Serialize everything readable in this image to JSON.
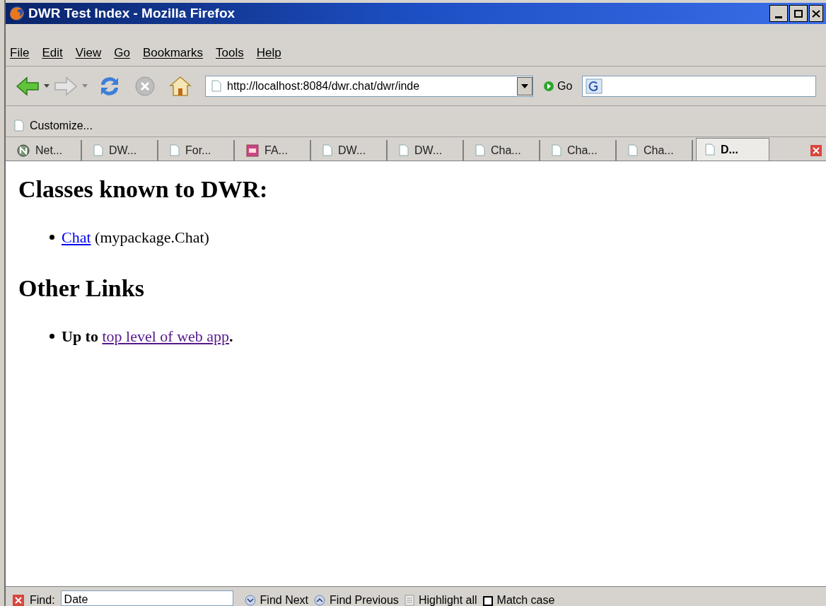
{
  "window": {
    "title": "DWR Test Index - Mozilla Firefox"
  },
  "menu": [
    "File",
    "Edit",
    "View",
    "Go",
    "Bookmarks",
    "Tools",
    "Help"
  ],
  "toolbar": {
    "url": "http://localhost:8084/dwr.chat/dwr/inde",
    "go": "Go"
  },
  "bookmarks": [
    "Customize..."
  ],
  "tabs": [
    {
      "label": "Net...",
      "kind": "globe",
      "selected": false
    },
    {
      "label": "DW...",
      "kind": "page",
      "selected": false
    },
    {
      "label": "For...",
      "kind": "page",
      "selected": false
    },
    {
      "label": "FA...",
      "kind": "jot",
      "selected": false
    },
    {
      "label": "DW...",
      "kind": "page",
      "selected": false
    },
    {
      "label": "DW...",
      "kind": "page",
      "selected": false
    },
    {
      "label": "Cha...",
      "kind": "page",
      "selected": false
    },
    {
      "label": "Cha...",
      "kind": "page",
      "selected": false
    },
    {
      "label": "Cha...",
      "kind": "page",
      "selected": false
    },
    {
      "label": "D...",
      "kind": "page",
      "selected": true
    }
  ],
  "content": {
    "sections": [
      {
        "heading": "Classes known to DWR:",
        "items": [
          {
            "link": "Chat",
            "after": " (mypackage.Chat)",
            "bold": false,
            "visited": false
          }
        ]
      },
      {
        "heading": "Other Links",
        "items": [
          {
            "before": "Up to ",
            "link": "top level of web app",
            "after": ".",
            "bold": true,
            "visited": true
          }
        ]
      }
    ]
  },
  "find_bar": {
    "label": "Find:",
    "value": "Date",
    "buttons": [
      "Find Next",
      "Find Previous",
      "Highlight all"
    ],
    "match_case": {
      "label": "Match case",
      "checked": false
    }
  }
}
